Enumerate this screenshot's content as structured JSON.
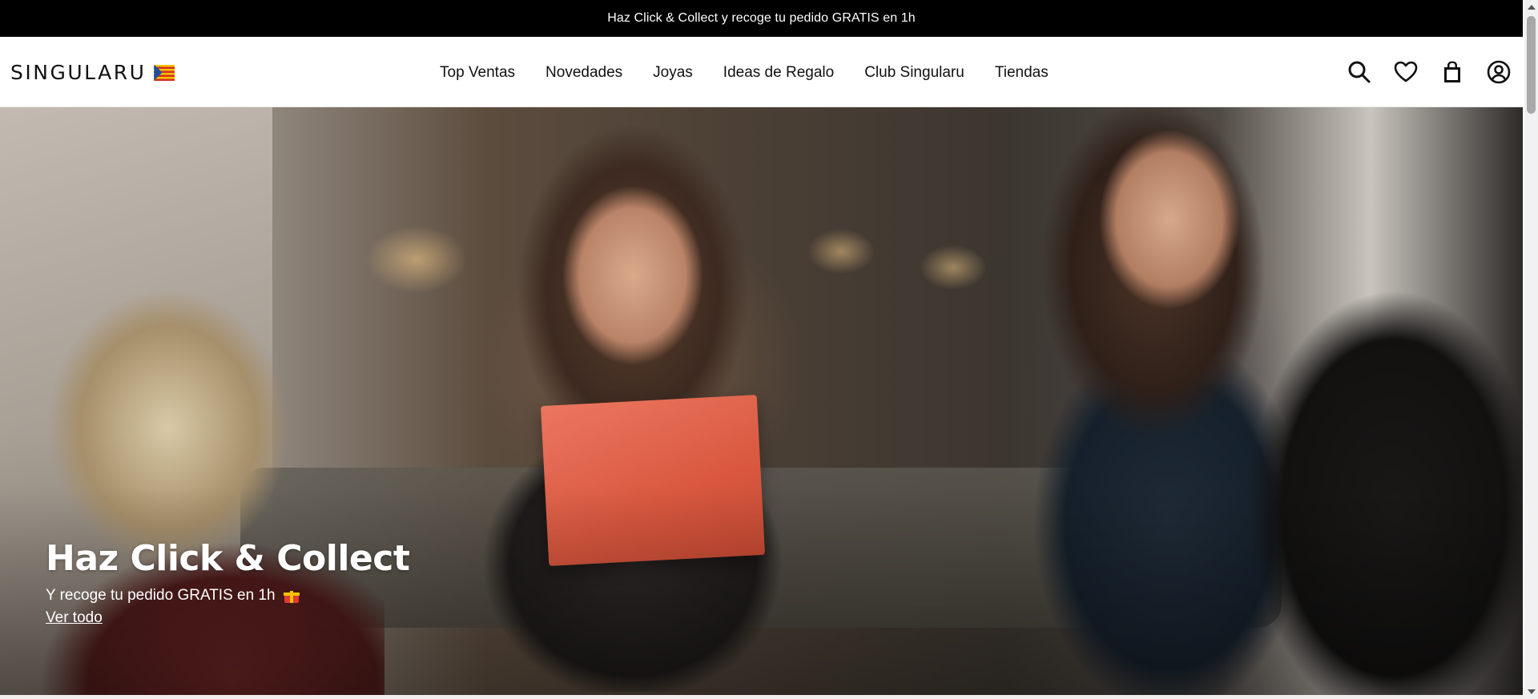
{
  "announcement": {
    "text": "Haz Click & Collect y recoge tu pedido GRATIS en 1h"
  },
  "header": {
    "logo_text": "SINGULARU",
    "flag_icon": "valencia-flag-icon",
    "nav": [
      {
        "label": "Top Ventas"
      },
      {
        "label": "Novedades"
      },
      {
        "label": "Joyas"
      },
      {
        "label": "Ideas de Regalo"
      },
      {
        "label": "Club Singularu"
      },
      {
        "label": "Tiendas"
      }
    ],
    "icons": [
      "search-icon",
      "heart-icon",
      "bag-icon",
      "account-icon"
    ]
  },
  "hero": {
    "title": "Haz Click & Collect",
    "subtitle": "Y recoge tu pedido GRATIS en 1h",
    "subtitle_icon": "gift-icon",
    "link_label": "Ver todo",
    "image_description_icon": "hero-photo"
  }
}
